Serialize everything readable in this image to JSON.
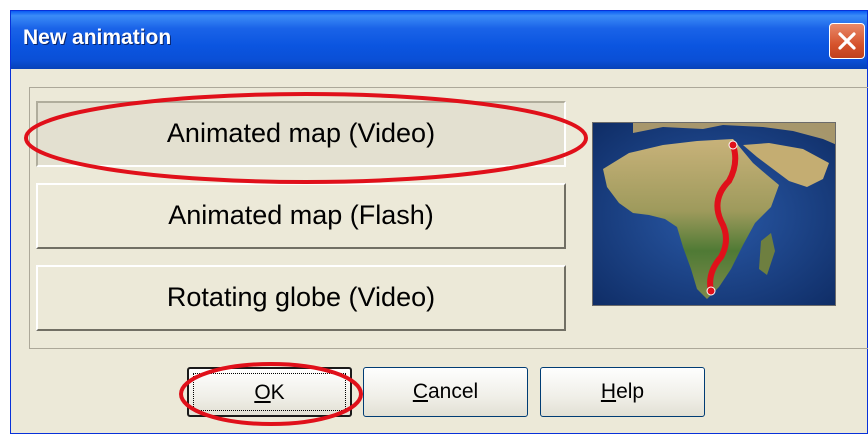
{
  "window": {
    "title": "New animation"
  },
  "options": [
    {
      "label": "Animated map (Video)",
      "selected": true
    },
    {
      "label": "Animated map (Flash)",
      "selected": false
    },
    {
      "label": "Rotating globe (Video)",
      "selected": false
    }
  ],
  "preview": {
    "icon": "africa-route-map-icon"
  },
  "buttons": {
    "ok": {
      "mnemonic": "O",
      "rest": "K"
    },
    "cancel": {
      "mnemonic": "C",
      "rest": "ancel"
    },
    "help": {
      "mnemonic": "H",
      "rest": "elp"
    }
  },
  "colors": {
    "titlebar": "#0a4fd6",
    "dialog_bg": "#ece9d8",
    "annotation": "#e0101a",
    "route": "#e0101a"
  }
}
